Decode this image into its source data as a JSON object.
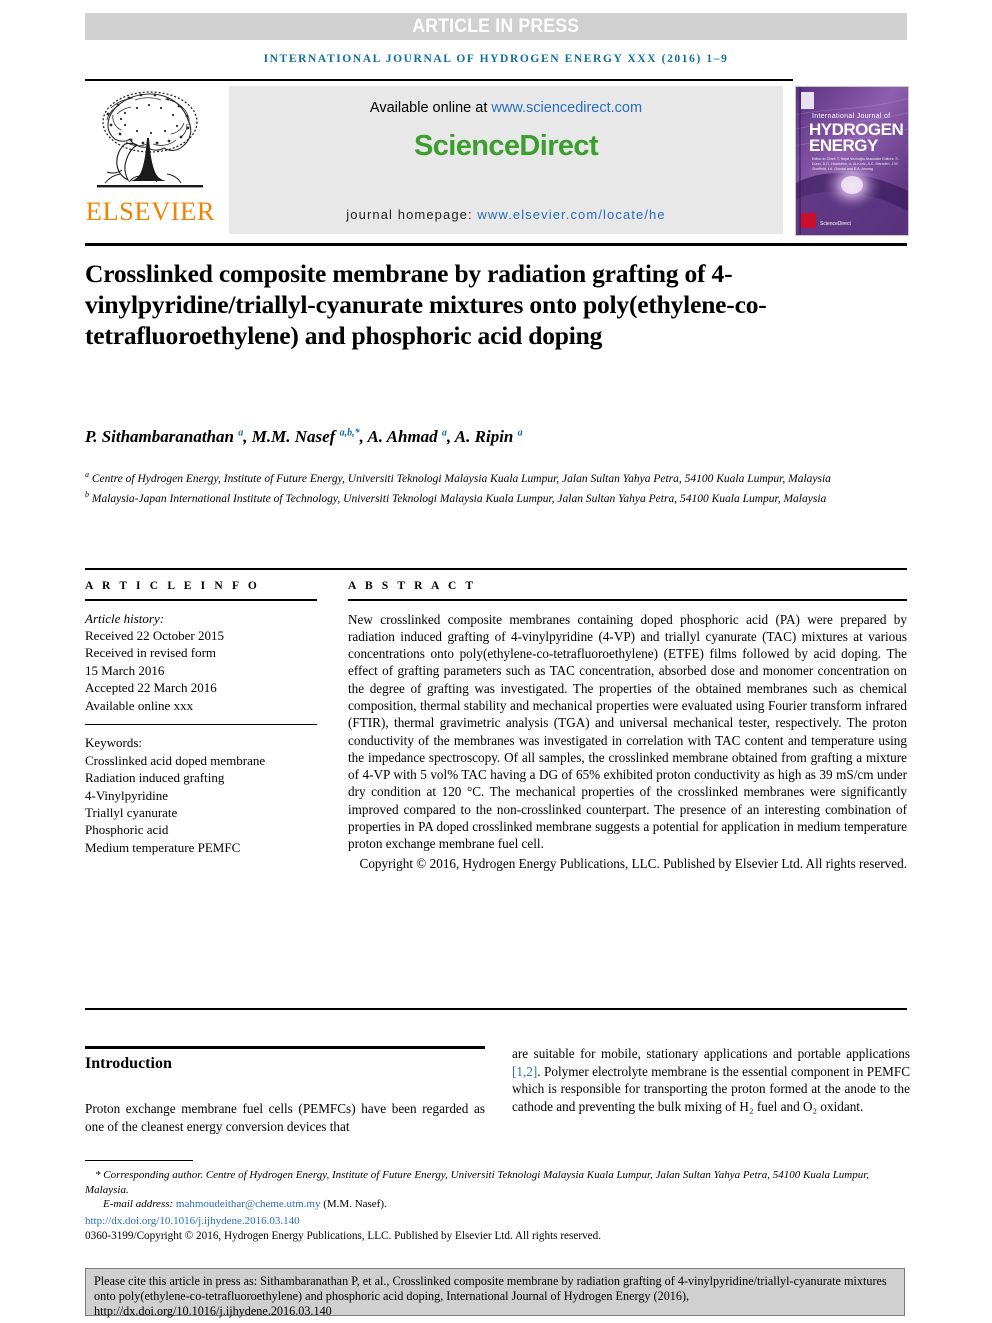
{
  "banner": {
    "article_in_press": "ARTICLE IN PRESS",
    "running_head": "INTERNATIONAL JOURNAL OF HYDROGEN ENERGY XXX (2016) 1–9"
  },
  "masthead": {
    "publisher": "ELSEVIER",
    "available_prefix": "Available online at ",
    "available_url": "www.sciencedirect.com",
    "sciencedirect_logo": "ScienceDirect",
    "homepage_prefix": "journal homepage: ",
    "homepage_url": "www.elsevier.com/locate/he",
    "cover": {
      "line1": "International Journal of",
      "line2": "HYDROGEN",
      "line3": "ENERGY",
      "editors": "Editor-in-Chief: T. Nejat Veziroğlu    Associate Editors: S. Dunn, D.G. Hazeldine, A. Al-Kurtz, A.C. Marsden, J.W. Sheffield, I.A. Gondal and E.A. Anurag",
      "sciencedirect": "ScienceDirect"
    }
  },
  "article": {
    "title": "Crosslinked composite membrane by radiation grafting of 4-vinylpyridine/triallyl-cyanurate mixtures onto poly(ethylene-co-tetrafluoroethylene) and phosphoric acid doping",
    "authors_html": "P. Sithambaranathan <sup>a</sup>, M.M. Nasef <sup>a,b,*</sup>, A. Ahmad <sup>a</sup>, A. Ripin <sup>a</sup>",
    "affiliation_a": "a Centre of Hydrogen Energy, Institute of Future Energy, Universiti Teknologi Malaysia Kuala Lumpur, Jalan Sultan Yahya Petra, 54100 Kuala Lumpur, Malaysia",
    "affiliation_b": "b Malaysia-Japan International Institute of Technology, Universiti Teknologi Malaysia Kuala Lumpur, Jalan Sultan Yahya Petra, 54100 Kuala Lumpur, Malaysia"
  },
  "article_info": {
    "heading": "A R T I C L E   I N F O",
    "history_label": "Article history:",
    "received": "Received 22 October 2015",
    "revised_label": "Received in revised form",
    "revised_date": "15 March 2016",
    "accepted": "Accepted 22 March 2016",
    "available_online": "Available online xxx",
    "keywords_label": "Keywords:",
    "keywords": [
      "Crosslinked acid doped membrane",
      "Radiation induced grafting",
      "4-Vinylpyridine",
      "Triallyl cyanurate",
      "Phosphoric acid",
      "Medium temperature PEMFC"
    ]
  },
  "abstract": {
    "heading": "A B S T R A C T",
    "text": "New crosslinked composite membranes containing doped phosphoric acid (PA) were prepared by radiation induced grafting of 4-vinylpyridine (4-VP) and triallyl cyanurate (TAC) mixtures at various concentrations onto poly(ethylene-co-tetrafluoroethylene) (ETFE) films followed by acid doping. The effect of grafting parameters such as TAC concentration, absorbed dose and monomer concentration on the degree of grafting was investigated. The properties of the obtained membranes such as chemical composition, thermal stability and mechanical properties were evaluated using Fourier transform infrared (FTIR), thermal gravimetric analysis (TGA) and universal mechanical tester, respectively. The proton conductivity of the membranes was investigated in correlation with TAC content and temperature using the impedance spectroscopy. Of all samples, the crosslinked membrane obtained from grafting a mixture of 4-VP with 5 vol% TAC having a DG of 65% exhibited proton conductivity as high as 39 mS/cm under dry condition at 120 °C. The mechanical properties of the crosslinked membranes were significantly improved compared to the non-crosslinked counterpart. The presence of an interesting combination of properties in PA doped crosslinked membrane suggests a potential for application in medium temperature proton exchange membrane fuel cell.",
    "copyright": "Copyright © 2016, Hydrogen Energy Publications, LLC. Published by Elsevier Ltd. All rights reserved."
  },
  "introduction": {
    "heading": "Introduction",
    "col_left": "Proton exchange membrane fuel cells (PEMFCs) have been regarded as one of the cleanest energy conversion devices that",
    "col_right_pre": "are suitable for mobile, stationary applications and portable applications ",
    "col_right_ref": "[1,2]",
    "col_right_post": ". Polymer electrolyte membrane is the essential component in PEMFC which is responsible for transporting the proton formed at the anode to the cathode and preventing the bulk mixing of H₂ fuel and O₂ oxidant."
  },
  "footnotes": {
    "corresponding": "* Corresponding author. Centre of Hydrogen Energy, Institute of Future Energy, Universiti Teknologi Malaysia Kuala Lumpur, Jalan Sultan Yahya Petra, 54100 Kuala Lumpur, Malaysia.",
    "email_label": "E-mail address: ",
    "email": "mahmoudeithar@cheme.utm.my",
    "email_suffix": " (M.M. Nasef).",
    "doi": "http://dx.doi.org/10.1016/j.ijhydene.2016.03.140",
    "issn_copyright": "0360-3199/Copyright © 2016, Hydrogen Energy Publications, LLC. Published by Elsevier Ltd. All rights reserved."
  },
  "cite_box": {
    "text": "Please cite this article in press as: Sithambaranathan P, et al., Crosslinked composite membrane by radiation grafting of 4-vinylpyridine/triallyl-cyanurate mixtures onto poly(ethylene-co-tetrafluoroethylene) and phosphoric acid doping, International Journal of Hydrogen Energy (2016), http://dx.doi.org/10.1016/j.ijhydene.2016.03.140"
  },
  "colors": {
    "link": "#2a6ebb",
    "journal_head": "#0f6e9e",
    "elsevier_orange": "#f08300",
    "sciencedirect_green": "#3c9e2e",
    "banner_gray": "#d0d0d0",
    "cover_purple": "#6a3f8f"
  }
}
